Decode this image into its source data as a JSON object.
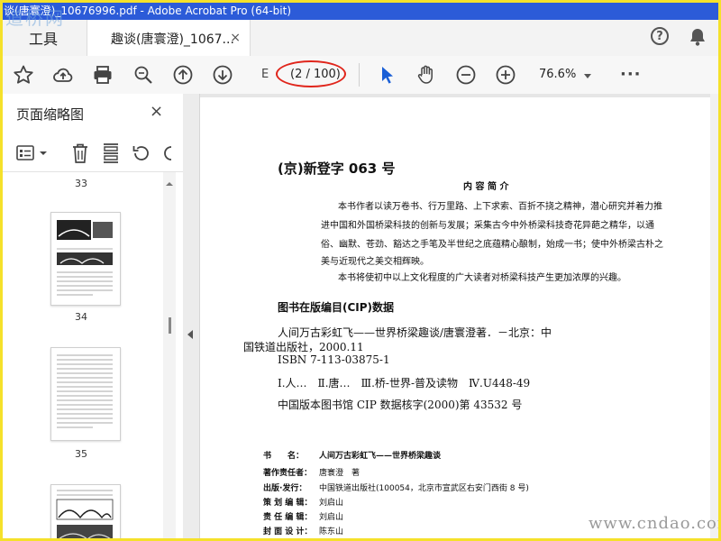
{
  "title_bar": {
    "title": "谈(唐寰澄)_10676996.pdf - Adobe Acrobat Pro (64-bit)",
    "watermark": "道桥网"
  },
  "tabs": {
    "tools_label": "工具",
    "document_label": "趣谈(唐寰澄)_1067...",
    "close_glyph": "×"
  },
  "toolbar": {
    "page_prefix": "E",
    "page_indicator": "(2 / 100)",
    "zoom": "76.6%",
    "more": "···",
    "icons": [
      "star-icon",
      "cloud-upload-icon",
      "print-icon",
      "zoom-search-icon",
      "page-up-icon",
      "page-down-icon",
      "select-arrow-icon",
      "hand-icon",
      "zoom-out-icon",
      "zoom-in-icon"
    ]
  },
  "left_panel": {
    "title": "页面缩略图",
    "close_glyph": "×",
    "thumbnails": [
      {
        "label": "33"
      },
      {
        "label": "34"
      },
      {
        "label": "35"
      }
    ]
  },
  "document": {
    "cip_number": "(京)新登字 063 号",
    "summary_title": "内 容 简 介",
    "summary_lines": [
      "本书作者以读万卷书、行万里路、上下求索、百折不挠之精神，潜心研究并着力推",
      "进中国和外国桥梁科技的创新与发展；采集古今中外桥梁科技奇花异葩之精华，以通",
      "俗、幽默、苍劲、豁达之手笔及半世纪之底蕴精心酿制，始成一书；使中外桥梁古朴之",
      "美与近现代之美交相辉映。",
      "本书将使初中以上文化程度的广大读者对桥梁科技产生更加浓厚的兴趣。"
    ],
    "cip_heading": "图书在版编目(CIP)数据",
    "cip_lines": [
      "人间万古彩虹飞——世界桥梁趣谈/唐寰澄著．－北京：中",
      "国铁道出版社，2000.11",
      "ISBN 7-113-03875-1",
      "Ⅰ.人…　Ⅱ.唐…　Ⅲ.桥-世界-普及读物　Ⅳ.U448-49",
      "中国版本图书馆 CIP 数据核字(2000)第 43532 号"
    ],
    "colophon": [
      {
        "key": "书　　名：",
        "value": "人间万古彩虹飞——世界桥梁趣谈"
      },
      {
        "key": "著作责任者：",
        "value": "唐寰澄　著"
      },
      {
        "key": "出版·发行：",
        "value": "中国铁道出版社(100054，北京市宣武区右安门西街 8 号)"
      },
      {
        "key": "策 划 编 辑：",
        "value": "刘启山"
      },
      {
        "key": "责 任 编 辑：",
        "value": "刘启山"
      },
      {
        "key": "封 面 设 计：",
        "value": "陈东山"
      }
    ]
  },
  "footer_watermark": "www.cndao.com",
  "colors": {
    "accent": "#2c5bd8",
    "highlight_ellipse": "#e0251b",
    "frame": "#f5e12a",
    "select_tool": "#1a5fd6"
  }
}
